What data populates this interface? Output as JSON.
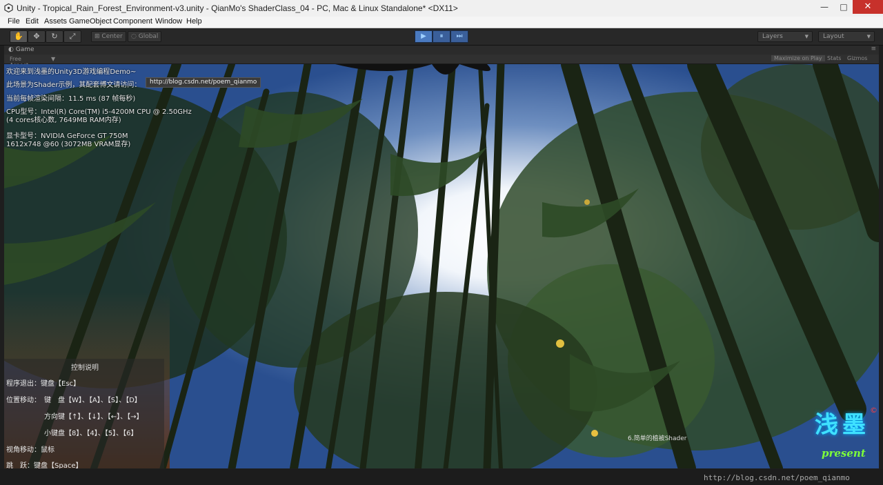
{
  "window": {
    "title": "Unity - Tropical_Rain_Forest_Environment-v3.unity - QianMo's ShaderClass_04 - PC, Mac & Linux Standalone* <DX11>",
    "controls": {
      "minimize": "—",
      "maximize": "□",
      "close": "✕"
    }
  },
  "menu": [
    "File",
    "Edit",
    "Assets",
    "GameObject",
    "Component",
    "Window",
    "Help"
  ],
  "toolbar": {
    "tools": [
      "hand-icon",
      "move-icon",
      "rotate-icon",
      "scale-icon"
    ],
    "pivot_center": "Center",
    "pivot_global": "Global",
    "play_glyphs": {
      "play": "▶",
      "pause": "⏸",
      "step": "⏭"
    },
    "layers": "Layers",
    "layout": "Layout"
  },
  "game_tab": {
    "label": "Game",
    "aspect": "Free Aspect",
    "maximize_on_play": "Maximize on Play",
    "stats": "Stats",
    "gizmos": "Gizmos"
  },
  "hud": {
    "line1": "欢迎来到浅墨的Unity3D游戏编程Demo~",
    "line2": "此场景为Shader示例，其配套博文请访问：",
    "url": "http://blog.csdn.net/poem_qianmo",
    "line3": "当前每帧渲染间隔：11.5 ms (87 帧每秒)",
    "cpu1": "CPU型号：Intel(R) Core(TM) i5-4200M CPU @ 2.50GHz",
    "cpu2": "(4 cores核心数, 7649MB RAM内存)",
    "gpu1": "显卡型号：NVIDIA GeForce GT 750M",
    "gpu2": "1612x748 @60 (3072MB VRAM显存)"
  },
  "controls_panel": {
    "title": "控制说明",
    "exit": "程序退出：键盘【Esc】",
    "move_label": "位置移动：",
    "move_keys": "键　盘【W】、【A】、【S】、【D】",
    "arrow_keys": "方向键【↑】、【↓】、【←】、【→】",
    "numpad_keys": "小键盘【8】、【4】、【5】、【6】",
    "view": "视角移动：鼠标",
    "jump": "跳　跃：键盘【Space】"
  },
  "shader_label": "6.简单的植被Shader",
  "logo": {
    "text1": "浅墨",
    "text2": "present",
    "mark": "©"
  },
  "watermark": "http://blog.csdn.net/poem_qianmo",
  "colors": {
    "accent": "#3a5f9a",
    "close": "#c7312b",
    "logo": "#3fe0ff",
    "logo_present": "#7dff3a"
  }
}
